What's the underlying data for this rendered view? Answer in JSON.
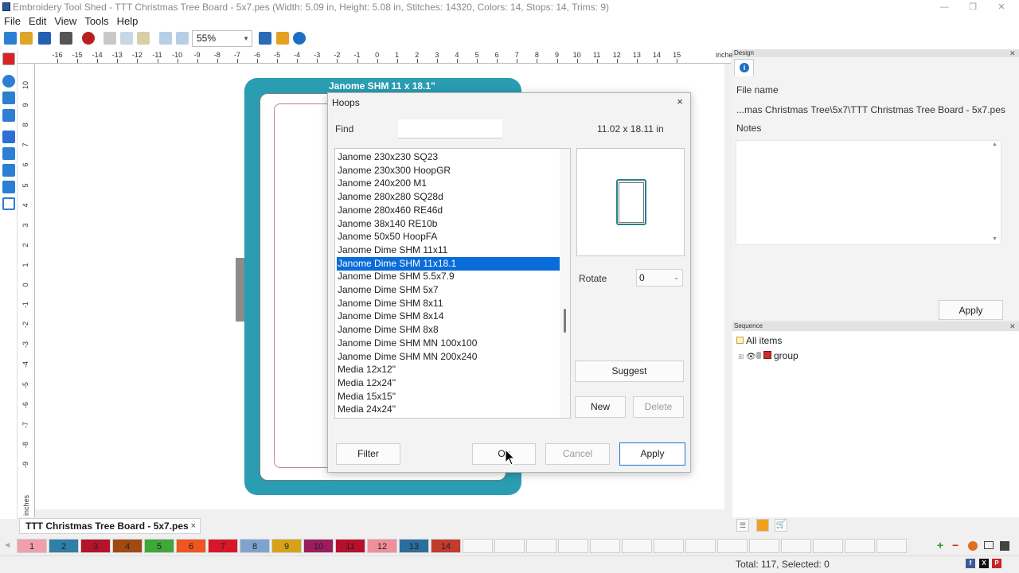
{
  "window": {
    "title": "Embroidery Tool Shed - TTT Christmas Tree Board - 5x7.pes (Width: 5.09 in, Height: 5.08 in, Stitches: 14320, Colors: 14, Stops: 14, Trims: 9)"
  },
  "menu": [
    "File",
    "Edit",
    "View",
    "Tools",
    "Help"
  ],
  "toolbar": {
    "zoom": "55%"
  },
  "ruler": {
    "unit": "inches",
    "h_ticks": [
      "-16",
      "-15",
      "-14",
      "-13",
      "-12",
      "-11",
      "-10",
      "-9",
      "-8",
      "-7",
      "-6",
      "-5",
      "-4",
      "-3",
      "-2",
      "-1",
      "0",
      "1",
      "2",
      "3",
      "4",
      "5",
      "6",
      "7",
      "8",
      "9",
      "10",
      "11",
      "12",
      "13",
      "14",
      "15"
    ],
    "v_ticks": [
      "10",
      "9",
      "8",
      "7",
      "6",
      "5",
      "4",
      "3",
      "2",
      "1",
      "0",
      "-1",
      "-2",
      "-3",
      "-4",
      "-5",
      "-6",
      "-7",
      "-8",
      "-9"
    ]
  },
  "canvas": {
    "hoop_label": "Janome SHM 11 x 18.1\""
  },
  "dialog": {
    "title": "Hoops",
    "close": "×",
    "find_label": "Find",
    "find_value": "",
    "dimensions": "11.02 x 18.11 in",
    "hoops": [
      "Janome 230x230 SQ23",
      "Janome 230x300 HoopGR",
      "Janome 240x200 M1",
      "Janome 280x280 SQ28d",
      "Janome 280x460 RE46d",
      "Janome 38x140 RE10b",
      "Janome 50x50 HoopFA",
      "Janome Dime SHM 11x11",
      "Janome Dime SHM 11x18.1",
      "Janome Dime SHM 5.5x7.9",
      "Janome Dime SHM 5x7",
      "Janome Dime SHM 8x11",
      "Janome Dime SHM 8x14",
      "Janome Dime SHM 8x8",
      "Janome Dime SHM MN 100x100",
      "Janome Dime SHM MN 200x240",
      "Media 12x12\"",
      "Media 12x24\"",
      "Media 15x15\"",
      "Media 24x24\""
    ],
    "selected_hoop": "Janome Dime SHM 11x18.1",
    "rotate_label": "Rotate",
    "rotate_value": "0",
    "suggest": "Suggest",
    "new": "New",
    "delete": "Delete",
    "filter": "Filter",
    "ok": "Ok",
    "cancel": "Cancel",
    "apply": "Apply"
  },
  "design_panel": {
    "header": "Design",
    "file_name_label": "File name",
    "file_name_value": "...mas Christmas Tree\\5x7\\TTT Christmas Tree Board - 5x7.pes",
    "notes_label": "Notes",
    "apply": "Apply"
  },
  "sequence_panel": {
    "header": "Sequence",
    "all_items": "All items",
    "group": "group"
  },
  "doc_tab": {
    "label": "TTT Christmas Tree Board - 5x7.pes",
    "close": "×"
  },
  "colors": [
    {
      "n": "1",
      "color": "#f0a0aa"
    },
    {
      "n": "2",
      "color": "#2f7fa6"
    },
    {
      "n": "3",
      "color": "#b3142a"
    },
    {
      "n": "4",
      "color": "#a04a12"
    },
    {
      "n": "5",
      "color": "#3fa83a"
    },
    {
      "n": "6",
      "color": "#f0561f"
    },
    {
      "n": "7",
      "color": "#d8162a"
    },
    {
      "n": "8",
      "color": "#7fa3cf"
    },
    {
      "n": "9",
      "color": "#d6a21a"
    },
    {
      "n": "10",
      "color": "#9a1e5e"
    },
    {
      "n": "11",
      "color": "#b7102d"
    },
    {
      "n": "12",
      "color": "#ef8f9a"
    },
    {
      "n": "13",
      "color": "#2a6f9c"
    },
    {
      "n": "14",
      "color": "#c23b2e"
    }
  ],
  "status": {
    "text": "Total: 117, Selected: 0"
  }
}
